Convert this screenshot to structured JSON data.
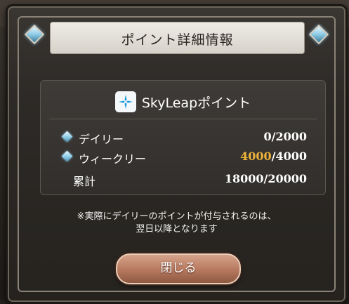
{
  "dialog": {
    "title": "ポイント詳細情報",
    "service_name": "SkyLeapポイント",
    "rows": {
      "daily": {
        "label": "デイリー",
        "value": "0/2000"
      },
      "weekly": {
        "label": "ウィークリー",
        "value_current": "4000",
        "value_max": "/4000"
      },
      "total": {
        "label": "累計",
        "value": "18000/20000"
      }
    },
    "notice_line1": "※実際にデイリーのポイントが付与されるのは、",
    "notice_line2": "翌日以降となります",
    "close_label": "閉じる"
  },
  "colors": {
    "accent_value": "#f0b33a",
    "close_button": "#b97c62",
    "gem_icon": "#8ccde8"
  }
}
